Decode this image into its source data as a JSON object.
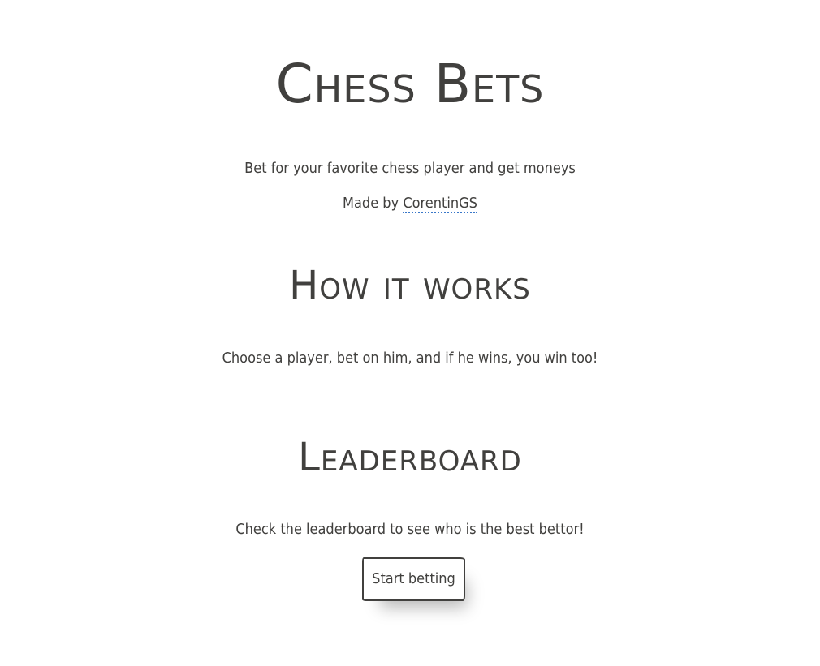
{
  "header": {
    "title": "Chess Bets",
    "tagline": "Bet for your favorite chess player and get moneys",
    "credit_prefix": "Made by ",
    "credit_link": "CorentinGS"
  },
  "how_it_works": {
    "heading": "How it works",
    "text": "Choose a player, bet on him, and if he wins, you win too!"
  },
  "leaderboard": {
    "heading": "Leaderboard",
    "text": "Check the leaderboard to see who is the best bettor!"
  },
  "cta": {
    "button_label": "Start betting"
  },
  "colors": {
    "text": "#41403e",
    "background": "#ffffff",
    "link_underline": "#3a78c9"
  }
}
